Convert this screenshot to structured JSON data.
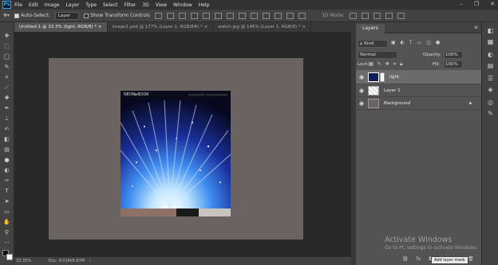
{
  "app": {
    "logo_text": "Ps"
  },
  "menu": [
    "File",
    "Edit",
    "Image",
    "Layer",
    "Type",
    "Select",
    "Filter",
    "3D",
    "View",
    "Window",
    "Help"
  ],
  "window_controls": [
    "–",
    "❐",
    "✕"
  ],
  "options_bar": {
    "auto_select_label": "Auto-Select:",
    "auto_select_value": "Layer",
    "show_transform_label": "Show Transform Controls",
    "mode_3d_label": "3D Mode:"
  },
  "tabs": [
    {
      "label": "Untitled-1 @ 33.3% (light, RGB/8) *  ×"
    },
    {
      "label": "image1.psd @ 177% (Layer 1, RGB/8#) *  ×"
    },
    {
      "label": "watch.jpg @ 146% (Layer 1, RGB/8) *  ×"
    }
  ],
  "canvas": {
    "photo_brand": "NEON▸BOOK",
    "photo_caption": "photographer name placeholder"
  },
  "status": {
    "zoom": "33.33%",
    "doc": "Doc: 9.01M/6.87M"
  },
  "layers_panel": {
    "tab_label": "Layers",
    "kind_label": "ρ Kind",
    "blend_mode": "Normal",
    "opacity_label": "Opacity:",
    "opacity_value": "100%",
    "lock_label": "Lock:",
    "fill_label": "Fill:",
    "fill_value": "100%",
    "layers": [
      {
        "name": "light",
        "selected": true
      },
      {
        "name": "Layer 1",
        "selected": false
      },
      {
        "name": "Background",
        "selected": false
      }
    ],
    "bottom_icons": [
      "fx",
      "◘"
    ],
    "tooltip": "Add layer mask"
  },
  "watermark": {
    "title": "Activate Windows",
    "subtitle": "Go to PC settings to activate Windows."
  },
  "colors": {
    "ui_dark": "#323232",
    "panel": "#424242",
    "canvas_bg": "#6a6362",
    "accent": "#31a8ff"
  }
}
